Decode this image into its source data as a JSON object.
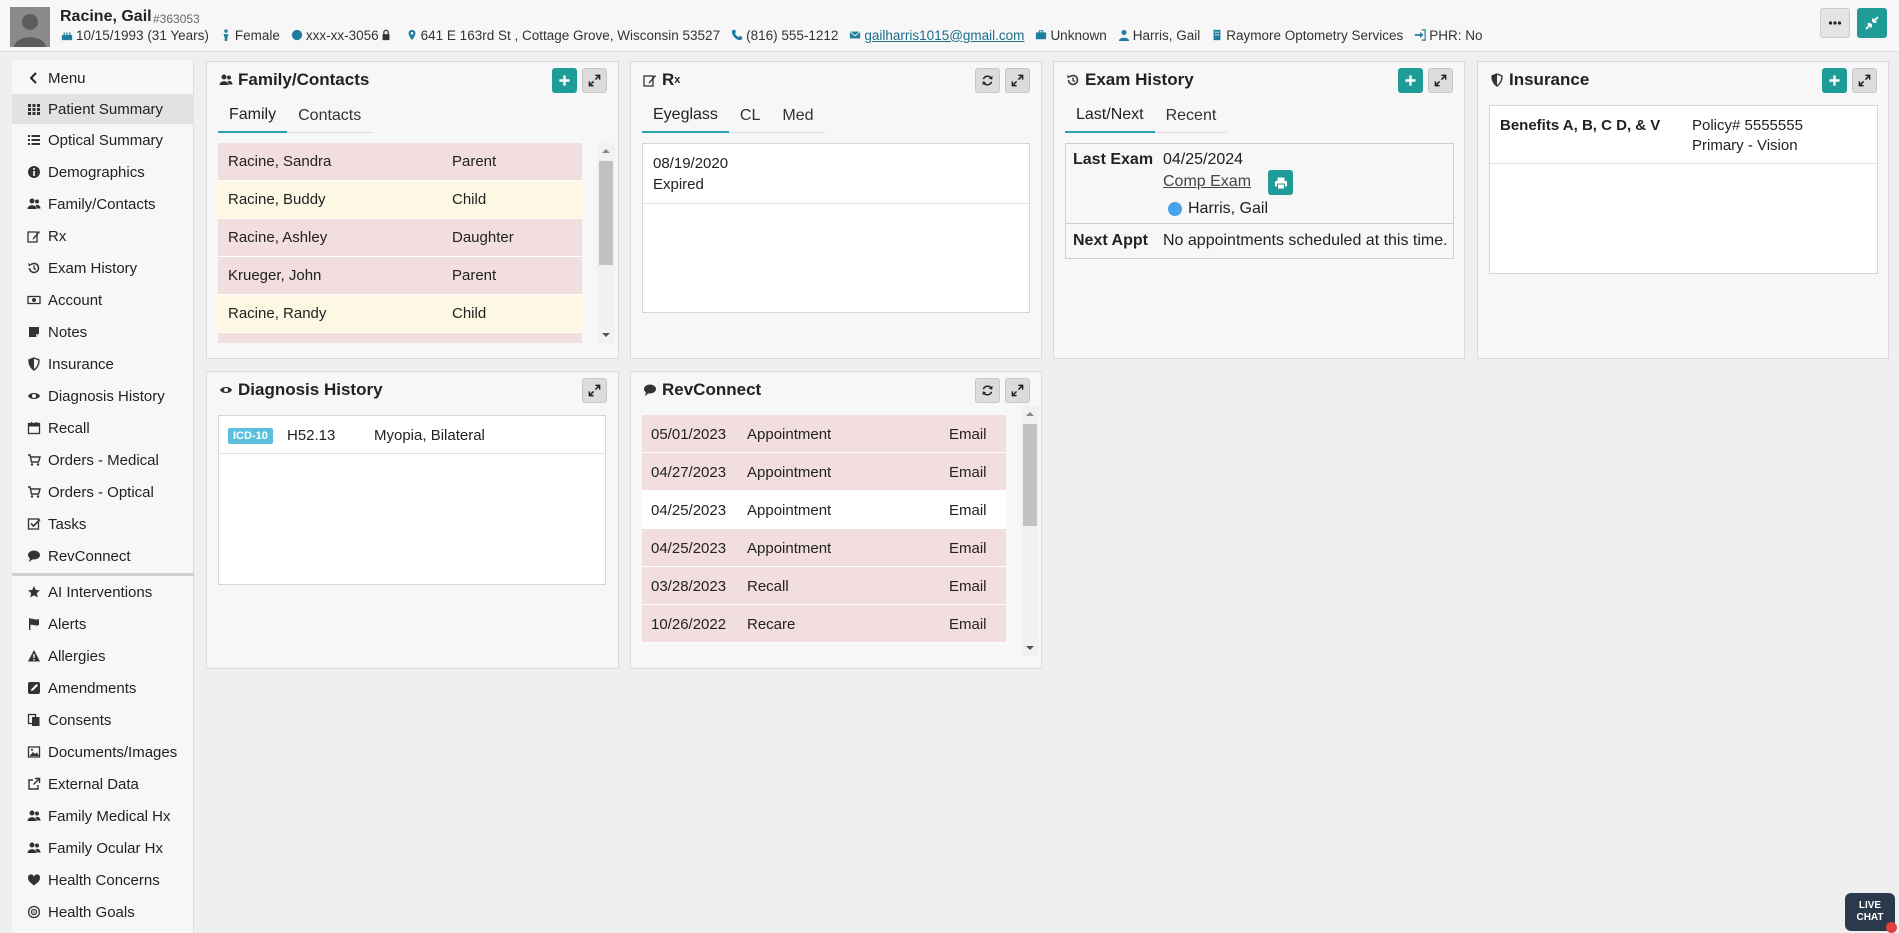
{
  "header": {
    "patient_name": "Racine, Gail",
    "patient_id": "#363053",
    "dob": "10/15/1993 (31 Years)",
    "sex": "Female",
    "ssn": "xxx-xx-3056",
    "address": "641 E 163rd St , Cottage Grove, Wisconsin 53527",
    "phone": "(816) 555-1212",
    "email": "gailharris1015@gmail.com",
    "employment": "Unknown",
    "provider": "Harris, Gail",
    "practice": "Raymore Optometry Services",
    "phr": "PHR: No"
  },
  "sidebar": {
    "menu_label": "Menu",
    "items": [
      {
        "label": "Patient Summary",
        "icon": "grid-icon"
      },
      {
        "label": "Optical Summary",
        "icon": "list-icon"
      },
      {
        "label": "Demographics",
        "icon": "info-icon"
      },
      {
        "label": "Family/Contacts",
        "icon": "users-icon"
      },
      {
        "label": "Rx",
        "icon": "edit-icon"
      },
      {
        "label": "Exam History",
        "icon": "history-icon"
      },
      {
        "label": "Account",
        "icon": "money-icon"
      },
      {
        "label": "Notes",
        "icon": "note-icon"
      },
      {
        "label": "Insurance",
        "icon": "shield-icon"
      },
      {
        "label": "Diagnosis History",
        "icon": "eye-icon"
      },
      {
        "label": "Recall",
        "icon": "calendar-icon"
      },
      {
        "label": "Orders - Medical",
        "icon": "cart-icon"
      },
      {
        "label": "Orders - Optical",
        "icon": "cart-icon"
      },
      {
        "label": "Tasks",
        "icon": "check-square-icon"
      },
      {
        "label": "RevConnect",
        "icon": "comment-icon"
      }
    ],
    "secondary_items": [
      {
        "label": "AI Interventions",
        "icon": "star-icon"
      },
      {
        "label": "Alerts",
        "icon": "flag-icon"
      },
      {
        "label": "Allergies",
        "icon": "warning-icon"
      },
      {
        "label": "Amendments",
        "icon": "pencil-square-icon"
      },
      {
        "label": "Consents",
        "icon": "copy-icon"
      },
      {
        "label": "Documents/Images",
        "icon": "image-icon"
      },
      {
        "label": "External Data",
        "icon": "external-link-icon"
      },
      {
        "label": "Family Medical Hx",
        "icon": "users-icon"
      },
      {
        "label": "Family Ocular Hx",
        "icon": "users-icon"
      },
      {
        "label": "Health Concerns",
        "icon": "heart-icon"
      },
      {
        "label": "Health Goals",
        "icon": "target-icon"
      }
    ]
  },
  "family_panel": {
    "title": "Family/Contacts",
    "tabs": [
      "Family",
      "Contacts"
    ],
    "rows": [
      {
        "name": "Racine, Sandra",
        "relation": "Parent"
      },
      {
        "name": "Racine, Buddy",
        "relation": "Child"
      },
      {
        "name": "Racine, Ashley",
        "relation": "Daughter"
      },
      {
        "name": "Krueger, John",
        "relation": "Parent"
      },
      {
        "name": "Racine, Randy",
        "relation": "Child"
      }
    ]
  },
  "rx_panel": {
    "title": "R",
    "title_sub": "x",
    "tabs": [
      "Eyeglass",
      "CL",
      "Med"
    ],
    "entry_date": "08/19/2020",
    "entry_status": "Expired"
  },
  "exam_panel": {
    "title": "Exam History",
    "tabs": [
      "Last/Next",
      "Recent"
    ],
    "last_exam_label": "Last Exam",
    "last_exam_date": "04/25/2024",
    "last_exam_type": "Comp Exam",
    "last_exam_provider": "Harris, Gail",
    "next_appt_label": "Next Appt",
    "next_appt_text": "No appointments scheduled at this time."
  },
  "insurance_panel": {
    "title": "Insurance",
    "benefits": "Benefits A, B, C D, & V",
    "policy": "Policy# 5555555",
    "plan": "Primary - Vision"
  },
  "diagnosis_panel": {
    "title": "Diagnosis History",
    "badge": "ICD-10",
    "code": "H52.13",
    "description": "Myopia, Bilateral"
  },
  "revconnect_panel": {
    "title": "RevConnect",
    "rows": [
      {
        "date": "05/01/2023",
        "type": "Appointment",
        "channel": "Email"
      },
      {
        "date": "04/27/2023",
        "type": "Appointment",
        "channel": "Email"
      },
      {
        "date": "04/25/2023",
        "type": "Appointment",
        "channel": "Email"
      },
      {
        "date": "04/25/2023",
        "type": "Appointment",
        "channel": "Email"
      },
      {
        "date": "03/28/2023",
        "type": "Recall",
        "channel": "Email"
      },
      {
        "date": "10/26/2022",
        "type": "Recare",
        "channel": "Email"
      }
    ]
  },
  "live_chat": {
    "line1": "LIVE",
    "line2": "CHAT"
  },
  "colors": {
    "teal": "#1f9b98",
    "row_pink": "#f2dede",
    "row_cream": "#fcf8e3",
    "tab_underline": "#28a1b0"
  }
}
